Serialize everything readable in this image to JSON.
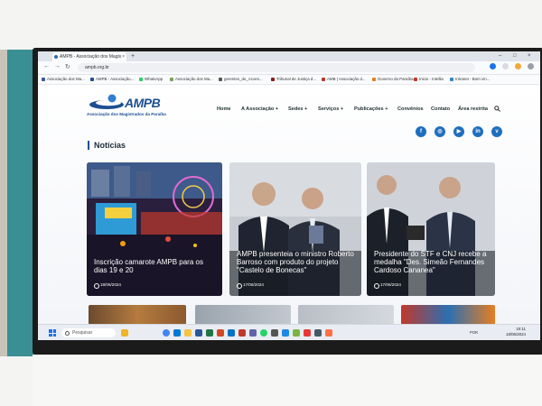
{
  "browser": {
    "tab_title": "AMPB - Associação dos Magis",
    "tab_close": "×",
    "new_tab": "+",
    "window_controls": [
      "–",
      "□",
      "×"
    ],
    "url": "ampb.org.br",
    "nav": {
      "back": "←",
      "forward": "→",
      "reload": "↻"
    },
    "bookmarks": [
      "Associação dos Ma...",
      "AMPB - Associação...",
      "WhatsApp",
      "Associação dos Ma...",
      "gerentes_de_Acoes...",
      "Tribunal de Justiça d...",
      "AMB | Associação d...",
      "Governo da Paraíba",
      "Inicio - Intellia",
      "Intranet - Bom vin..."
    ]
  },
  "site": {
    "logo_text": "AMPB",
    "logo_subtitle": "Associação dos Magistrados da Paraíba",
    "nav": [
      "Home",
      "A Associação +",
      "Sedes +",
      "Serviços +",
      "Publicações +",
      "Convênios",
      "Contato",
      "Área restrita"
    ],
    "social": [
      {
        "icon": "facebook-icon",
        "glyph": "f"
      },
      {
        "icon": "instagram-icon",
        "glyph": "◎"
      },
      {
        "icon": "youtube-icon",
        "glyph": "▶"
      },
      {
        "icon": "linkedin-icon",
        "glyph": "in"
      },
      {
        "icon": "vimeo-icon",
        "glyph": "v"
      }
    ],
    "section_title": "Notícias",
    "cards": [
      {
        "title": "Inscrição camarote AMPB para os dias 19 e 20",
        "date": "18/06/2024"
      },
      {
        "title": "AMPB presenteia o ministro Roberto Barroso com produto do projeto \"Castelo de Bonecas\"",
        "date": "17/06/2024"
      },
      {
        "title": "Presidente do STF e CNJ recebe a medalha \"Des. Simeão Fernandes Cardoso Cananea\"",
        "date": "17/06/2024"
      }
    ]
  },
  "taskbar": {
    "search_placeholder": "Pesquisar",
    "clock_time": "10:11",
    "clock_date": "18/06/2024",
    "tray_lang": "POR"
  },
  "colors": {
    "accent": "#1d4f91",
    "social": "#1f6fbf"
  }
}
